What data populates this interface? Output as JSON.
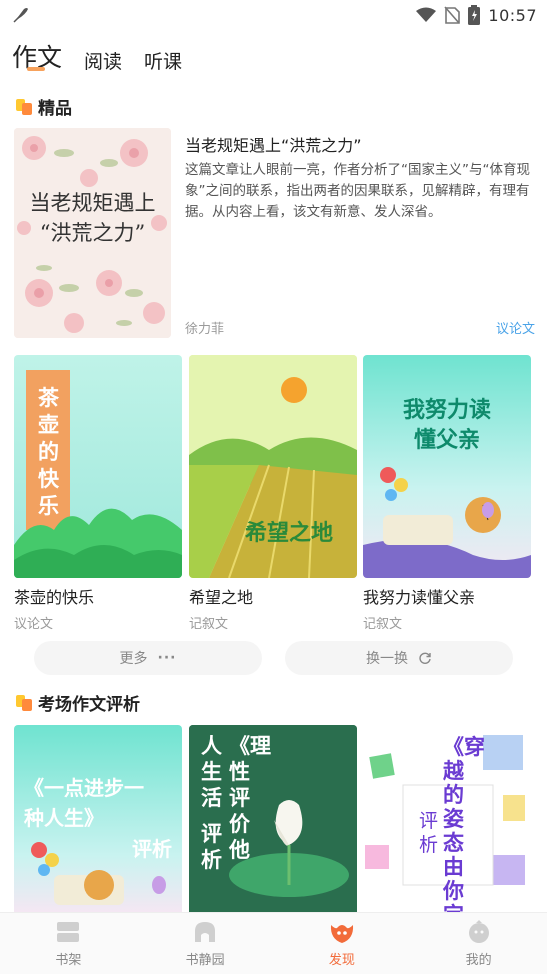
{
  "status_bar": {
    "time": "10:57"
  },
  "top_tabs": [
    {
      "label": "作文",
      "active": true
    },
    {
      "label": "阅读",
      "active": false
    },
    {
      "label": "听课",
      "active": false
    }
  ],
  "sections": {
    "featured": {
      "title": "精品"
    },
    "exam": {
      "title": "考场作文评析"
    }
  },
  "featured": {
    "cover_text_line1": "当老规矩遇上",
    "cover_text_line2": "“洪荒之力”",
    "title": "当老规矩遇上“洪荒之力”",
    "description": "这篇文章让人眼前一亮，作者分析了“国家主义”与“体育现象”之间的联系，指出两者的因果联系，见解精辟，有理有据。从内容上看，该文有新意、发人深省。",
    "author": "徐力菲",
    "genre": "议论文"
  },
  "books": [
    {
      "cover_text": "茶壶的快乐",
      "title": "茶壶的快乐",
      "genre": "议论文"
    },
    {
      "cover_text": "希望之地",
      "title": "希望之地",
      "genre": "记叙文"
    },
    {
      "cover_text_line1": "我努力读",
      "cover_text_line2": "懂父亲",
      "title": "我努力读懂父亲",
      "genre": "记叙文"
    }
  ],
  "actions": {
    "more": "更多",
    "refresh": "换一换"
  },
  "exam_books": [
    {
      "cover_text_line1": "《一点进步一",
      "cover_text_line2": "种人生》",
      "cover_text_line3": "评析"
    },
    {
      "cover_text_col1": "人生活",
      "cover_text_col2": "《理性评价他",
      "cover_text_col3": "评析"
    },
    {
      "cover_text_col1": "《穿越的姿态由你定",
      "cover_text_col2": "评析"
    }
  ],
  "bottom_nav": [
    {
      "label": "书架",
      "icon": "bookshelf-icon"
    },
    {
      "label": "书静园",
      "icon": "garden-icon"
    },
    {
      "label": "发现",
      "icon": "discover-icon",
      "active": true
    },
    {
      "label": "我的",
      "icon": "profile-icon"
    }
  ],
  "colors": {
    "accent": "#f26b3a",
    "link": "#4aa3e8",
    "indicator": "#f7a25c"
  }
}
